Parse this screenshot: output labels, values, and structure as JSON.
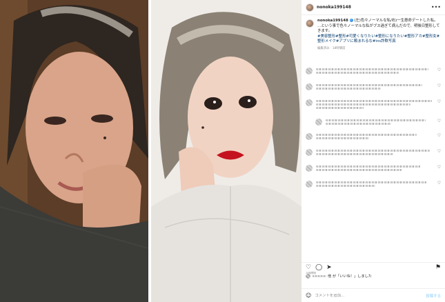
{
  "post": {
    "username": "nonoka199148",
    "more_glyph": "•••",
    "caption_text": "(左)色々ノーマルな私/右)一生懸命デートした私。\n…という事で色々ノーマルな私がブス過ぎて病んだので、明後日整形してきます。",
    "hashtags": "#美容整形#整形#可愛くなりたい#整形になりたい#整形アカ#整形女#整形メイク#アプリに頼まれるな#ins詐欺写真",
    "caption_meta": "編集済み · 18時間前",
    "verified_glyph": "✓",
    "date": "19時間前",
    "likes_text": "他 が「いいね！」しました",
    "comment_placeholder": "コメントを追加...",
    "post_button": "投稿する"
  },
  "icons": {
    "heart": "♡",
    "comment": "◯",
    "share": "➤",
    "bookmark": "⚑",
    "emoji": "☺"
  },
  "colors": {
    "link": "#00376b",
    "verified": "#3897f0",
    "muted": "#8e8e8e"
  }
}
